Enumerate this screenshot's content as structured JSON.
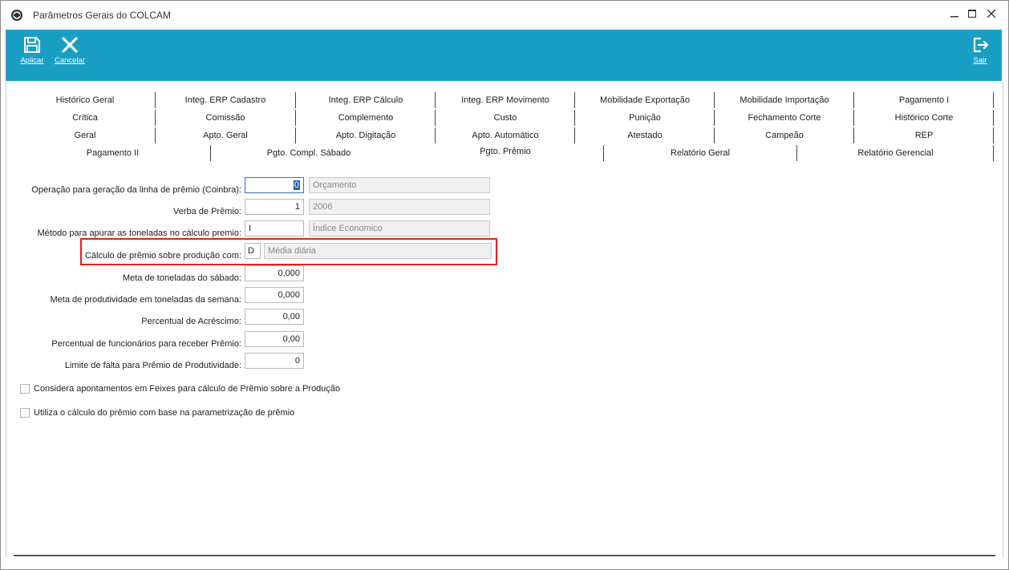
{
  "window": {
    "title": "Parâmetros Gerais do COLCAM"
  },
  "toolbar": {
    "apply": "Aplicar",
    "cancel": "Cancelar",
    "exit": "Sair",
    "color": "#1a9fc4"
  },
  "tabs": {
    "row1": [
      "Histórico Geral",
      "Integ. ERP Cadastro",
      "Integ. ERP Cálculo",
      "Integ. ERP Movimento",
      "Mobilidade Exportação",
      "Mobilidade Importação",
      "Pagamento I"
    ],
    "row2": [
      "Crítica",
      "Comissão",
      "Complemento",
      "Custo",
      "Punição",
      "Fechamento Corte",
      "Histórico Corte"
    ],
    "row3": [
      "Geral",
      "Apto. Geral",
      "Apto. Digitação",
      "Apto. Automático",
      "Atestado",
      "Campeão",
      "REP"
    ],
    "row4": [
      "Pagamento II",
      "Pgto. Compl. Sábado",
      "Pgto. Prêmio",
      "Relatório Geral",
      "Relatório Gerencial"
    ],
    "active": "Pgto. Prêmio"
  },
  "form": {
    "op_label": "Operação para geração da linha de prêmio (Coinbra):",
    "op_value": "0",
    "op_desc": "Orçamento",
    "verba_label": "Verba de Prêmio:",
    "verba_value": "1",
    "verba_desc": "2006",
    "metodo_label": "Método para apurar as toneladas no cálculo premio:",
    "metodo_value": "I",
    "metodo_desc": "Índice Economico",
    "calc_label": "Cálculo de prêmio sobre produção com:",
    "calc_value": "D",
    "calc_desc": "Média diária",
    "meta_sab_label": "Meta de toneladas do sábado:",
    "meta_sab_value": "0,000",
    "meta_sem_label": "Meta de produtividade em toneladas da semana:",
    "meta_sem_value": "0,000",
    "perc_acr_label": "Percentual de Acréscimo:",
    "perc_acr_value": "0,00",
    "perc_func_label": "Percentual de funcionários para receber Prêmio:",
    "perc_func_value": "0,00",
    "limite_label": "Limite de falta para Prêmio de Produtividade:",
    "limite_value": "0"
  },
  "checkboxes": {
    "feixes": {
      "label": "Considera apontamentos em Feixes para cálculo de Prêmio sobre a Produção",
      "checked": false
    },
    "parametrizacao": {
      "label": "Utiliza o cálculo do prêmio com base na parametrização de prêmio",
      "checked": false
    }
  }
}
